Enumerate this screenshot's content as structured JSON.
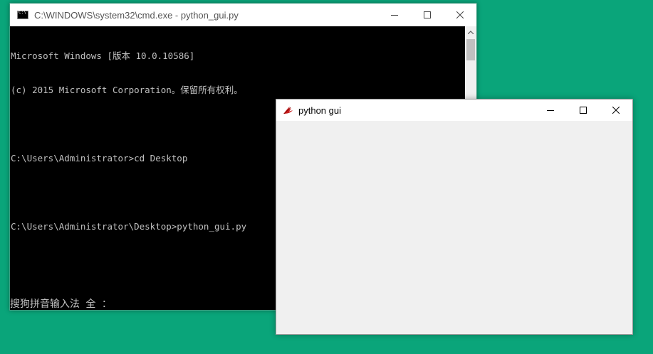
{
  "cmd_window": {
    "title": "C:\\WINDOWS\\system32\\cmd.exe - python_gui.py",
    "lines": [
      "Microsoft Windows [版本 10.0.10586]",
      "(c) 2015 Microsoft Corporation。保留所有权利。",
      "",
      "C:\\Users\\Administrator>cd Desktop",
      "",
      "C:\\Users\\Administrator\\Desktop>python_gui.py"
    ],
    "ime_status": "搜狗拼音输入法 全 ："
  },
  "tk_window": {
    "title": "python gui"
  },
  "colors": {
    "desktop": "#0aa57a",
    "console_bg": "#000000",
    "console_text": "#c0c0c0",
    "tk_body": "#f0f0f0"
  },
  "icons": {
    "cmd_app": "cmd-icon",
    "tk_app": "tk-feather-icon",
    "minimize": "minimize-icon",
    "maximize": "maximize-icon",
    "close": "close-icon"
  }
}
